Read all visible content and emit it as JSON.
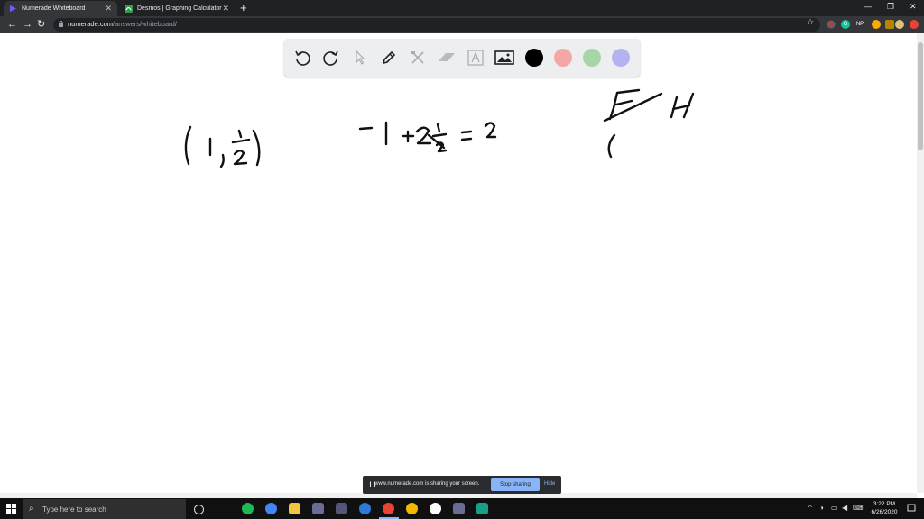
{
  "tabs": [
    {
      "label": "Numerade Whiteboard",
      "icon": "numerade-play-icon",
      "active": true
    },
    {
      "label": "Desmos | Graphing Calculator",
      "icon": "desmos-icon",
      "active": false
    }
  ],
  "address_bar": {
    "domain": "numerade.com",
    "path": "/answers/whiteboard/"
  },
  "extensions": [
    {
      "name": "extension-red-icon",
      "color": "#d93025"
    },
    {
      "name": "grammarly-icon",
      "color": "#15c39a"
    },
    {
      "name": "np-extension-icon",
      "label": "NP",
      "color": "#35363a"
    },
    {
      "name": "extension-yellow-icon",
      "color": "#f9ab00"
    },
    {
      "name": "extension-yellow2-icon",
      "color": "#fbbc04"
    },
    {
      "name": "profile-avatar-icon",
      "color": "#e0c080"
    },
    {
      "name": "extension-red2-icon",
      "color": "#ea4335"
    }
  ],
  "whiteboard": {
    "tools": [
      "undo-icon",
      "redo-icon",
      "pointer-icon",
      "pen-icon",
      "tools-icon",
      "eraser-icon",
      "text-icon",
      "image-icon"
    ],
    "colors": [
      "#000000",
      "#f4a7a7",
      "#a8d5a6",
      "#b5b3ef"
    ],
    "selected_color": "#000000",
    "handwriting": [
      "(1, 1/2)",
      "-1 + 2·1/2 = 2",
      "E H",
      "("
    ]
  },
  "share_banner": {
    "message": "www.numerade.com is sharing your screen.",
    "stop_label": "Stop sharing",
    "hide_label": "Hide"
  },
  "taskbar": {
    "search_placeholder": "Type here to search",
    "time": "3:22 PM",
    "date": "6/26/2020",
    "apps": [
      {
        "name": "cortana-icon",
        "color": "#101010"
      },
      {
        "name": "spotify-icon",
        "color": "#1db954"
      },
      {
        "name": "chrome-g-icon",
        "color": "#4285f4"
      },
      {
        "name": "file-explorer-icon",
        "color": "#f4c542"
      },
      {
        "name": "app-icon",
        "color": "#6b6b9a"
      },
      {
        "name": "app-icon-2",
        "color": "#55557a"
      },
      {
        "name": "app-icon-blue",
        "color": "#2d7bd6"
      },
      {
        "name": "chrome-icon",
        "color": "#ea4335"
      },
      {
        "name": "norton-icon",
        "color": "#f5b800"
      },
      {
        "name": "app-icon-white",
        "color": "#ffffff"
      },
      {
        "name": "app-icon-3",
        "color": "#6b6b9a"
      },
      {
        "name": "app-icon-green",
        "color": "#16a085"
      }
    ]
  }
}
